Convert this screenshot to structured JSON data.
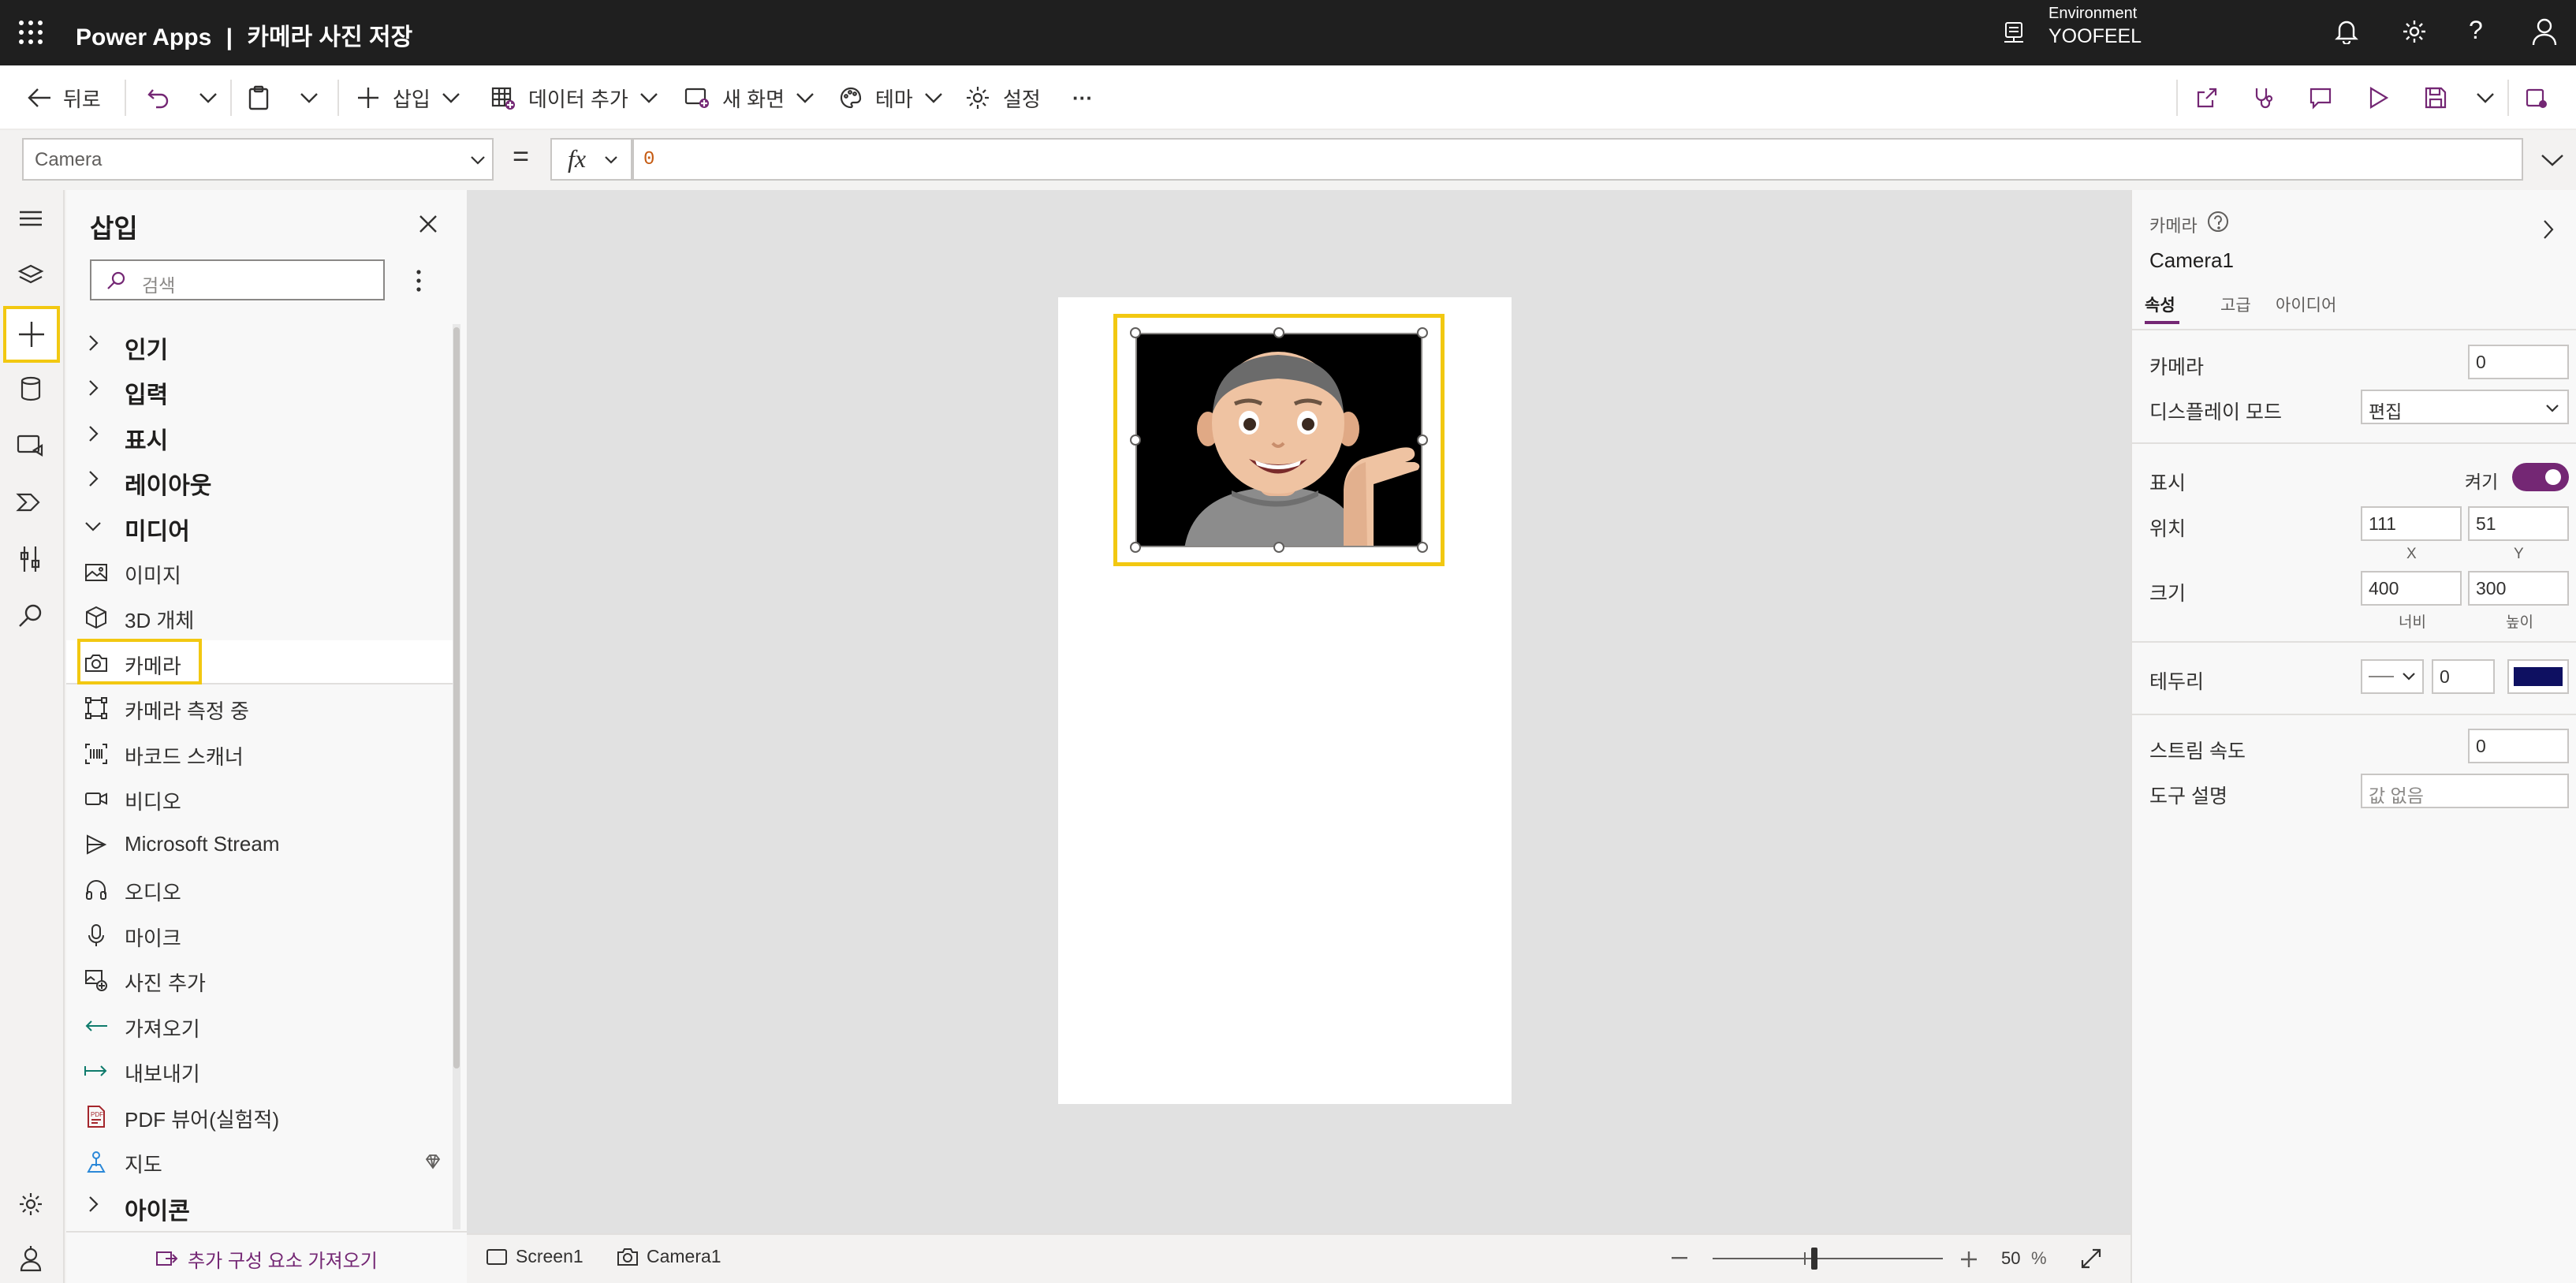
{
  "app": {
    "name": "Power Apps",
    "separator": "|",
    "project": "카메라 사진 저장"
  },
  "environment": {
    "label": "Environment",
    "name": "YOOFEEL"
  },
  "toolbar": {
    "back": "뒤로",
    "insert": "삽입",
    "add_data": "데이터 추가",
    "new_screen": "새 화면",
    "theme": "테마",
    "settings": "설정",
    "more": "···"
  },
  "formula": {
    "property": "Camera",
    "equals": "=",
    "fx": "fx",
    "value": "0"
  },
  "insert_panel": {
    "title": "삽입",
    "search_placeholder": "검색",
    "categories_top": [
      "인기",
      "입력",
      "표시",
      "레이아웃",
      "미디어"
    ],
    "media_items": [
      "이미지",
      "3D 개체",
      "카메라",
      "카메라 측정 중",
      "바코드 스캐너",
      "비디오",
      "Microsoft Stream",
      "오디오",
      "마이크",
      "사진 추가",
      "가져오기",
      "내보내기",
      "PDF 뷰어(실험적)",
      "지도"
    ],
    "category_bottom": "아이콘",
    "footer_link": "추가 구성 요소 가져오기"
  },
  "status": {
    "screen": "Screen1",
    "control": "Camera1",
    "zoom": "50",
    "zoom_unit": "%",
    "zoom_level": 0.5
  },
  "properties": {
    "control_type": "카메라",
    "control_name": "Camera1",
    "tabs": [
      "속성",
      "고급",
      "아이디어"
    ],
    "camera_label": "카메라",
    "camera_value": "0",
    "display_mode_label": "디스플레이 모드",
    "display_mode_value": "편집",
    "visible_label": "표시",
    "visible_state": "켜기",
    "position_label": "위치",
    "x": "111",
    "y": "51",
    "x_label": "X",
    "y_label": "Y",
    "size_label": "크기",
    "width": "400",
    "height": "300",
    "width_label": "너비",
    "height_label": "높이",
    "border_label": "테두리",
    "border_width": "0",
    "border_color": "#0e1061",
    "stream_rate_label": "스트림 속도",
    "stream_rate": "0",
    "tooltip_label": "도구 설명",
    "tooltip_placeholder": "값 없음"
  },
  "colors": {
    "accent": "#742774",
    "highlight": "#f2c811",
    "topbar": "#1f1f1f"
  }
}
